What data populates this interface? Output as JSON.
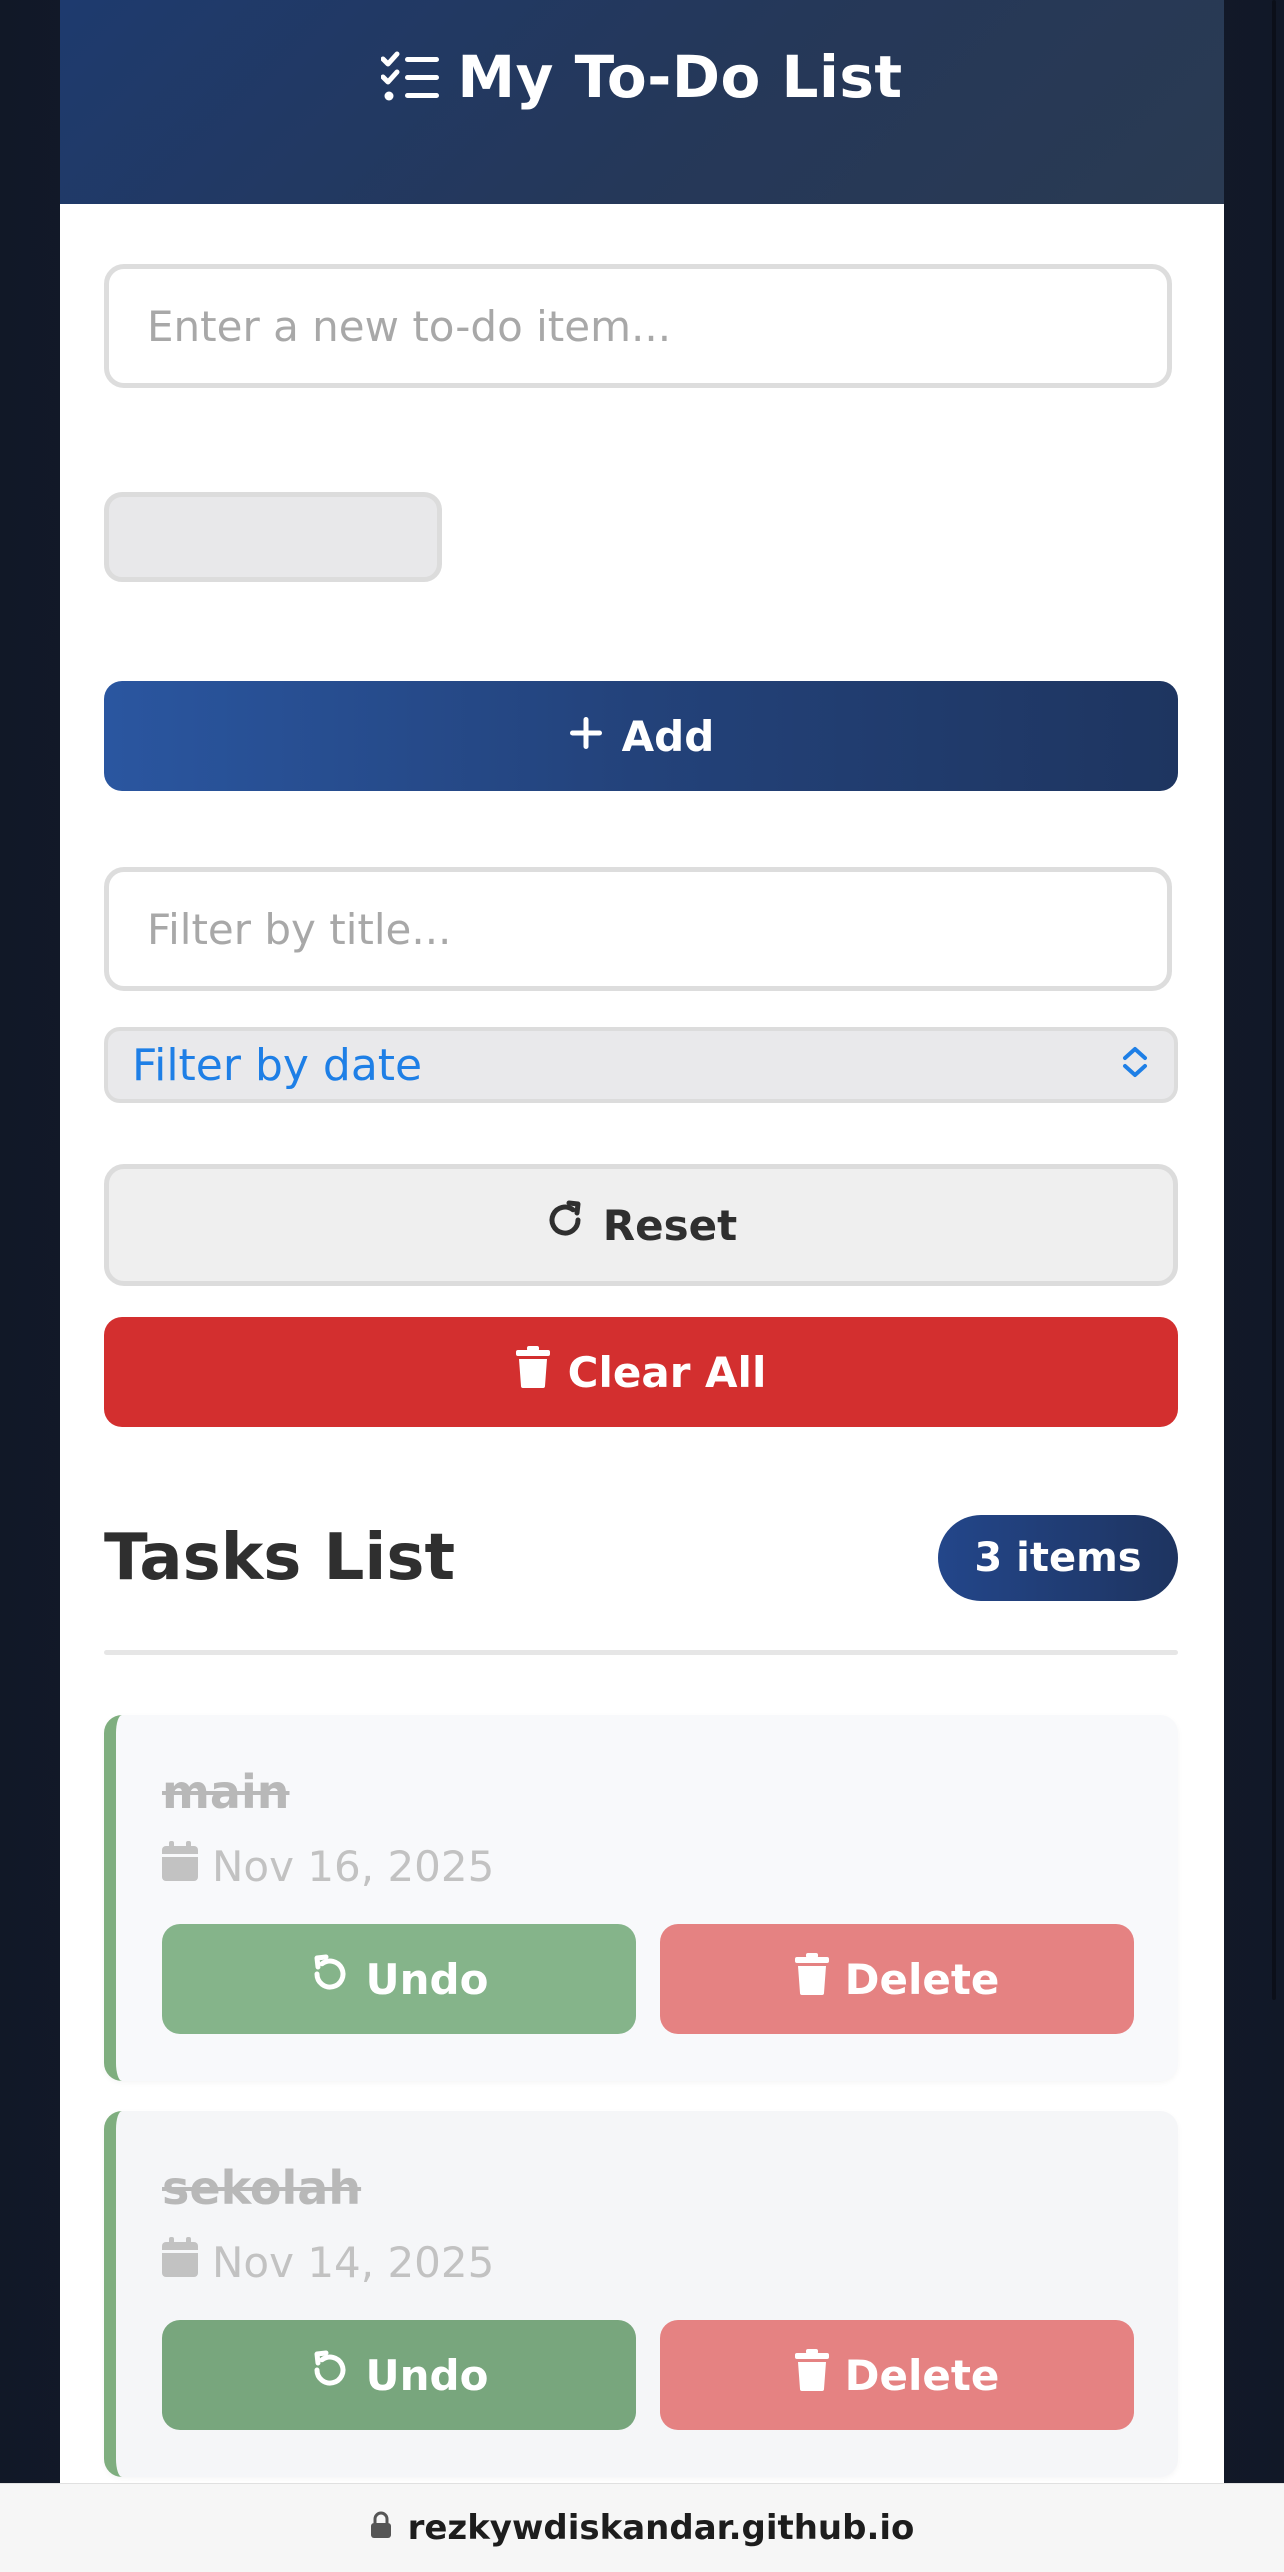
{
  "header": {
    "title": "My To-Do List",
    "icon": "list-check-icon"
  },
  "form": {
    "todo_placeholder": "Enter a new to-do item...",
    "add_label": "Add"
  },
  "filters": {
    "title_placeholder": "Filter by title...",
    "date_label": "Filter by date",
    "reset_label": "Reset",
    "clear_label": "Clear All"
  },
  "tasks_section": {
    "title": "Tasks List",
    "count_label": "3 items"
  },
  "tasks": [
    {
      "title": "main",
      "date": "Nov 16, 2025",
      "undo_label": "Undo",
      "delete_label": "Delete"
    },
    {
      "title": "sekolah",
      "date": "Nov 14, 2025",
      "undo_label": "Undo",
      "delete_label": "Delete"
    }
  ],
  "browser": {
    "url": "rezkywdiskandar.github.io"
  },
  "colors": {
    "primary": "#23427a",
    "danger": "#d32f2f",
    "success": "#85b48a",
    "link": "#1e7fe6"
  }
}
